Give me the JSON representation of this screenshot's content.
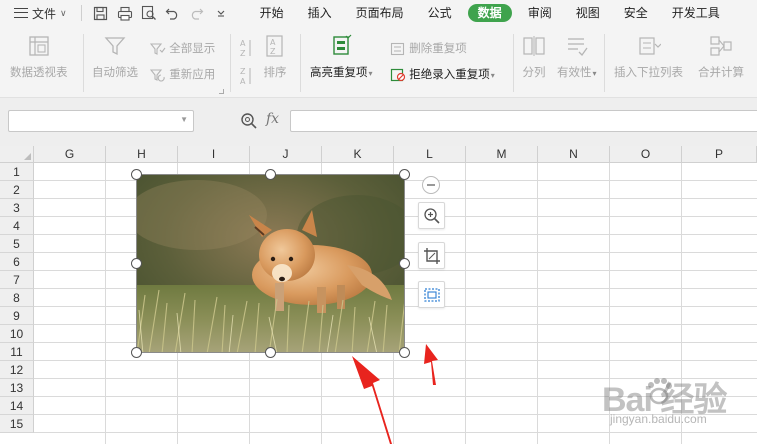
{
  "menubar": {
    "file_label": "文件",
    "tabs": [
      "开始",
      "插入",
      "页面布局",
      "公式",
      "数据",
      "审阅",
      "视图",
      "安全",
      "开发工具"
    ],
    "active_tab": "数据"
  },
  "ribbon": {
    "pivot_table": "数据透视表",
    "auto_filter": "自动筛选",
    "show_all": "全部显示",
    "reapply": "重新应用",
    "sort": "排序",
    "highlight_duplicates": "高亮重复项",
    "delete_duplicates": "删除重复项",
    "reject_duplicate_entry": "拒绝录入重复项",
    "split_columns": "分列",
    "validity": "有效性",
    "insert_dropdown": "插入下拉列表",
    "consolidate": "合并计算"
  },
  "formula_bar": {
    "name_box_value": "",
    "fx_label": "fx",
    "formula_value": ""
  },
  "grid": {
    "columns": [
      "G",
      "H",
      "I",
      "J",
      "K",
      "L",
      "M",
      "N",
      "O",
      "P"
    ],
    "rows": [
      "1",
      "2",
      "3",
      "4",
      "5",
      "6",
      "7",
      "8",
      "9",
      "10",
      "11",
      "12",
      "13",
      "14",
      "15"
    ]
  },
  "watermark": {
    "brand": "Bai  经验",
    "url": "jingyan.baidu.com"
  },
  "colors": {
    "accent": "#3fa34d",
    "arrow": "#e8241e",
    "tab_bar": "#f4f4f4",
    "grid_line": "#dadada"
  }
}
